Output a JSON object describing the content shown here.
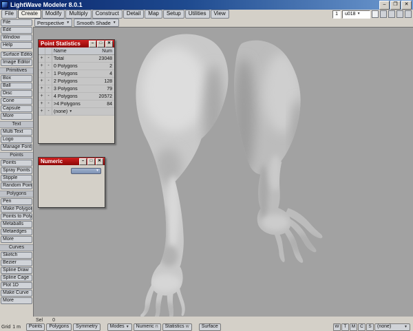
{
  "window": {
    "title": "LightWave Modeler 8.0.1"
  },
  "menu": {
    "items": [
      "File",
      "Create",
      "Modify",
      "Multiply",
      "Construct",
      "Detail",
      "Map",
      "Setup",
      "Utilities",
      "View"
    ]
  },
  "topright": {
    "layer_value": "1",
    "object_name": "u018"
  },
  "viewport_controls": {
    "view_mode": "Perspective",
    "shade_mode": "Smooth Shade"
  },
  "sidebar": {
    "top_items": [
      "File",
      "Edit",
      "Window",
      "Help"
    ],
    "editors": [
      "Surface Editor",
      "Image Editor"
    ],
    "sections": [
      {
        "title": "Primitives",
        "items": [
          "Box",
          "Ball",
          "Disc",
          "Cone",
          "Capsule",
          "More"
        ]
      },
      {
        "title": "Text",
        "items": [
          "Multi Text",
          "Logo",
          "Manage Fonts"
        ]
      },
      {
        "title": "Points",
        "items": [
          "Points",
          "Spray Points",
          "Stipple",
          "Random Points"
        ]
      },
      {
        "title": "Polygons",
        "items": [
          "Pen",
          "Make Polygon",
          "Points to Polys",
          "Metaballs",
          "Metaedges",
          "More"
        ]
      },
      {
        "title": "Curves",
        "items": [
          "Sketch",
          "Bezier",
          "Spline Draw",
          "Spline Cage",
          "Plot 1D",
          "Make Curve",
          "More"
        ]
      }
    ]
  },
  "statistics_window": {
    "title": "Point Statistics",
    "plus_label": "+",
    "minus_label": "-",
    "columns": {
      "name": "Name",
      "num": "Num"
    },
    "rows": [
      {
        "name": "Total",
        "num": "23048"
      },
      {
        "name": "0 Polygons",
        "num": "2"
      },
      {
        "name": "1 Polygons",
        "num": "4"
      },
      {
        "name": "2 Polygons",
        "num": "128"
      },
      {
        "name": "3 Polygons",
        "num": "79"
      },
      {
        "name": "4 Polygons",
        "num": "20572"
      },
      {
        "name": ">4 Polygons",
        "num": "84"
      },
      {
        "name": "(none)",
        "num": ""
      }
    ]
  },
  "numeric_window": {
    "title": "Numeric"
  },
  "statusbar": {
    "sel_label": "Sel",
    "sel_value": "0",
    "grid_label": "Grid",
    "grid_value": "1 m",
    "mode_points": "Points",
    "mode_polygons": "Polygons",
    "symmetry": "Symmetry",
    "modes": "Modes",
    "numeric": "Numeric",
    "numeric_key": "n",
    "statistics": "Statistics",
    "statistics_key": "w",
    "surface": "Surface",
    "vmap_buttons": [
      "W",
      "T",
      "M",
      "C",
      "S"
    ],
    "vmap_value": "(none)"
  }
}
